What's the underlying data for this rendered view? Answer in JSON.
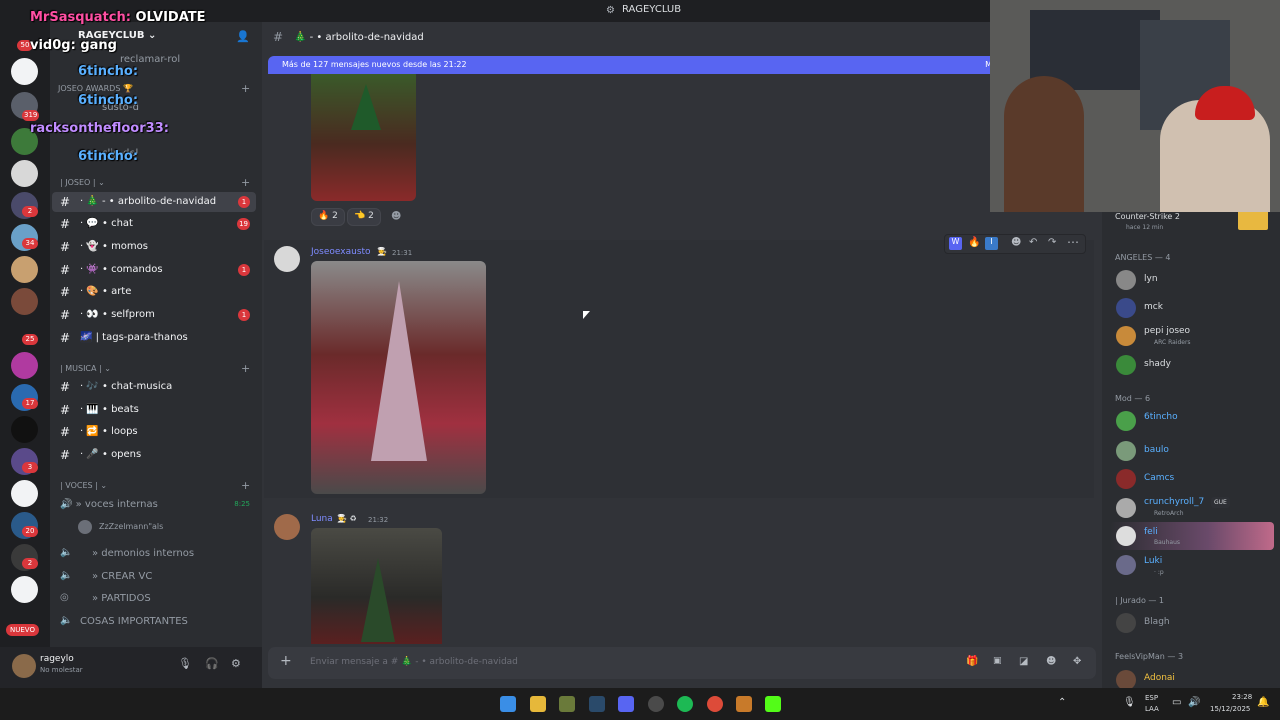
{
  "window": {
    "title": "RAGEYCLUB"
  },
  "server": {
    "name": "RAGEYCLUB ⌄"
  },
  "stream_overlay": [
    {
      "user": "MrSasquatch:",
      "text": "OLVIDATE",
      "color": "#ff4fa3"
    },
    {
      "user": "vid0g:",
      "text": "gang",
      "color": "#ffffff"
    },
    {
      "user": "6tincho:",
      "text": "",
      "color": "#5ab0ff"
    },
    {
      "user": "6tincho:",
      "text": "",
      "color": "#5ab0ff"
    },
    {
      "user": "racksonthefloor33:",
      "text": "",
      "color": "#c08cff"
    },
    {
      "user": "6tincho:",
      "text": "",
      "color": "#5ab0ff"
    }
  ],
  "channels_partial": {
    "reclamar": "reclamar-rol",
    "awards": "JOSEO AWARDS 🏆",
    "susto": "susto-d",
    "clip": "clip-del"
  },
  "categories": {
    "joseo": "| JOSEO | ⌄",
    "musica": "| MUSICA | ⌄",
    "voces": "| VOCES | ⌄"
  },
  "channels": [
    {
      "label": "· 🎄 - • arbolito-de-navidad",
      "badge": "1"
    },
    {
      "label": "· 💬 • chat",
      "badge": "19"
    },
    {
      "label": "· 👻 • momos",
      "badge": ""
    },
    {
      "label": "· 👾 • comandos",
      "badge": "1"
    },
    {
      "label": "· 🎨 • arte",
      "badge": ""
    },
    {
      "label": "· 👀 • selfprom",
      "badge": "1"
    },
    {
      "label": "🌌 | tags-para-thanos",
      "badge": ""
    }
  ],
  "music_channels": [
    "· 🎶 • chat-musica",
    "· 🎹 • beats",
    "· 🔁 • loops",
    "· 🎤 • opens"
  ],
  "voice": {
    "interna": "🔊 » voces internas",
    "timer": "8:25",
    "member": "ZzZzelmann\"als",
    "demonios": "» demonios internos",
    "crear": "» CREAR VC",
    "partidos": "» PARTIDOS",
    "importantes": "COSAS IMPORTANTES"
  },
  "guild_badges": [
    "319",
    "2",
    "34",
    "25",
    "17",
    "3",
    "20",
    "2"
  ],
  "guild_new": "NUEVO",
  "guild_top_badge": "50",
  "user": {
    "name": "rageylo",
    "status": "No molestar"
  },
  "chat": {
    "channel": "🎄 - • arbolito-de-navidad",
    "newbar": "Más de 127 mensajes nuevos desde las 21:22",
    "newbar_right": "M",
    "reactions": [
      {
        "emoji": "🔥",
        "count": "2"
      },
      {
        "emoji": "👈",
        "count": "2"
      }
    ],
    "messages": [
      {
        "author": "Joseoexausto",
        "badge": "🧑‍🍳",
        "time": "21:31"
      },
      {
        "author": "Luna",
        "badge": "🧑‍🍳 ♻",
        "time": "21:32"
      }
    ],
    "input_placeholder": "Enviar mensaje a # 🎄 - • arbolito-de-navidad"
  },
  "members": {
    "top_activity": "Counter-Strike 2",
    "top_activity_sub": "hace 12 min",
    "groups": [
      {
        "title": "ANGELES — 4",
        "items": [
          {
            "name": "lyn",
            "sub": "",
            "color": "#949ba4"
          },
          {
            "name": "mck",
            "sub": "",
            "color": "#949ba4"
          },
          {
            "name": "pepi joseo",
            "sub": "ARC Raiders",
            "color": "#949ba4"
          },
          {
            "name": "shady",
            "sub": "",
            "color": "#949ba4"
          }
        ]
      },
      {
        "title": "Mod — 6",
        "items": [
          {
            "name": "6tincho",
            "sub": "",
            "color": "#5ab0ff"
          },
          {
            "name": "baulo",
            "sub": "",
            "color": "#5ab0ff"
          },
          {
            "name": "Camcs",
            "sub": "",
            "color": "#5ab0ff"
          },
          {
            "name": "crunchyroll_7",
            "sub": "RetroArch",
            "color": "#5ab0ff",
            "tag": "GUE"
          },
          {
            "name": "feli",
            "sub": "Bauhaus",
            "color": "#5ab0ff"
          },
          {
            "name": "Luki",
            "sub": "· :p",
            "color": "#5ab0ff"
          }
        ]
      },
      {
        "title": "| Jurado — 1",
        "items": [
          {
            "name": "Blagh",
            "sub": "",
            "color": "#949ba4"
          }
        ]
      },
      {
        "title": "FeelsVipMan — 3",
        "items": [
          {
            "name": "Adonai",
            "sub": "",
            "color": "#f0c040"
          }
        ]
      }
    ]
  },
  "taskbar": {
    "lang1": "ESP",
    "lang2": "LAA",
    "time": "23:28",
    "date": "15/12/2025"
  },
  "colors": {
    "accent": "#5865f2",
    "badge": "#da373c",
    "bg": "#313338"
  }
}
